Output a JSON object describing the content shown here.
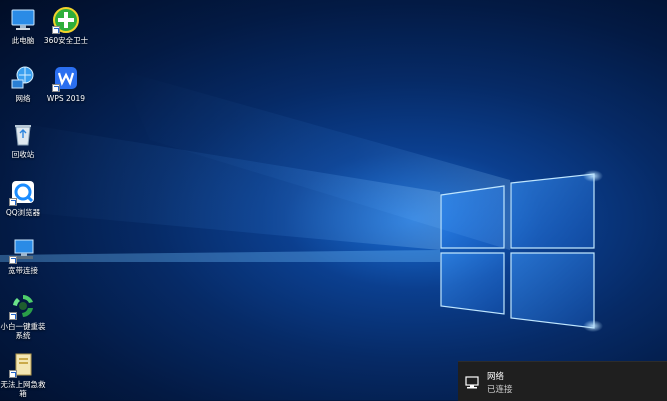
{
  "desktop": {
    "icons": [
      {
        "label": "此电脑",
        "icon": "computer-icon"
      },
      {
        "label": "360安全卫士",
        "icon": "360-security-icon"
      },
      {
        "label": "网络",
        "icon": "network-globe-icon"
      },
      {
        "label": "WPS 2019",
        "icon": "wps-icon"
      },
      {
        "label": "回收站",
        "icon": "recycle-bin-icon"
      },
      {
        "label": "QQ浏览器",
        "icon": "qq-browser-icon"
      },
      {
        "label": "宽带连接",
        "icon": "broadband-connection-icon"
      },
      {
        "label": "小白一键重装系统",
        "icon": "xiaobai-reinstall-icon"
      },
      {
        "label": "无法上网急救箱",
        "icon": "network-rescue-icon"
      }
    ]
  },
  "notification": {
    "title": "网络",
    "status": "已连接",
    "icon": "ethernet-icon"
  },
  "colors": {
    "accent": "#1a6fd6",
    "toast_bg": "#1f1f1f"
  }
}
